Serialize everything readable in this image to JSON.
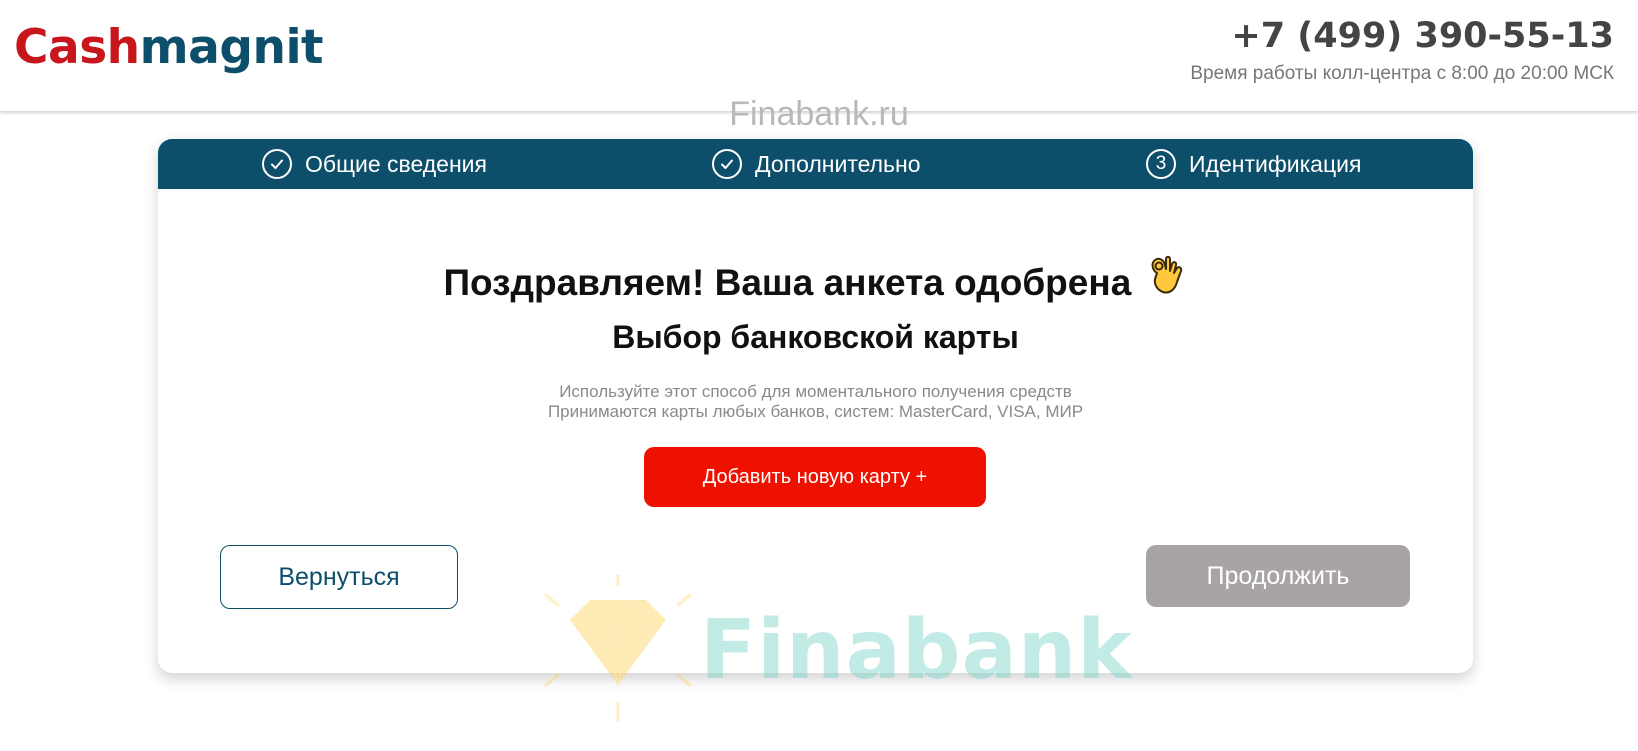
{
  "header": {
    "logo_part1": "Cash",
    "logo_part2": "magnit",
    "phone": "+7 (499) 390-55-13",
    "hours": "Время работы колл-центра с 8:00 до 20:00 МСК"
  },
  "watermark": {
    "top": "Finabank.ru",
    "bottom": "Finabank"
  },
  "steps": [
    {
      "label": "Общие сведения",
      "state": "done"
    },
    {
      "label": "Дополнительно",
      "state": "done"
    },
    {
      "label": "Идентификация",
      "state": "current",
      "number": "3"
    }
  ],
  "main": {
    "title": "Поздравляем! Ваша анкета одобрена",
    "subtitle": "Выбор банковской карты",
    "desc_line1": "Используйте этот способ для моментального получения средств",
    "desc_line2": "Принимаются карты любых банков, систем: MasterCard, VISA, МИР",
    "add_card_label": "Добавить новую карту +",
    "back_label": "Вернуться",
    "continue_label": "Продолжить"
  },
  "colors": {
    "brand_red": "#c8161d",
    "brand_blue": "#0d4f6b",
    "accent_button": "#ee1100",
    "disabled_button": "#a9a4a4"
  },
  "icons": {
    "step_done": "check-circle-icon",
    "emoji": "ok-hand-icon"
  }
}
